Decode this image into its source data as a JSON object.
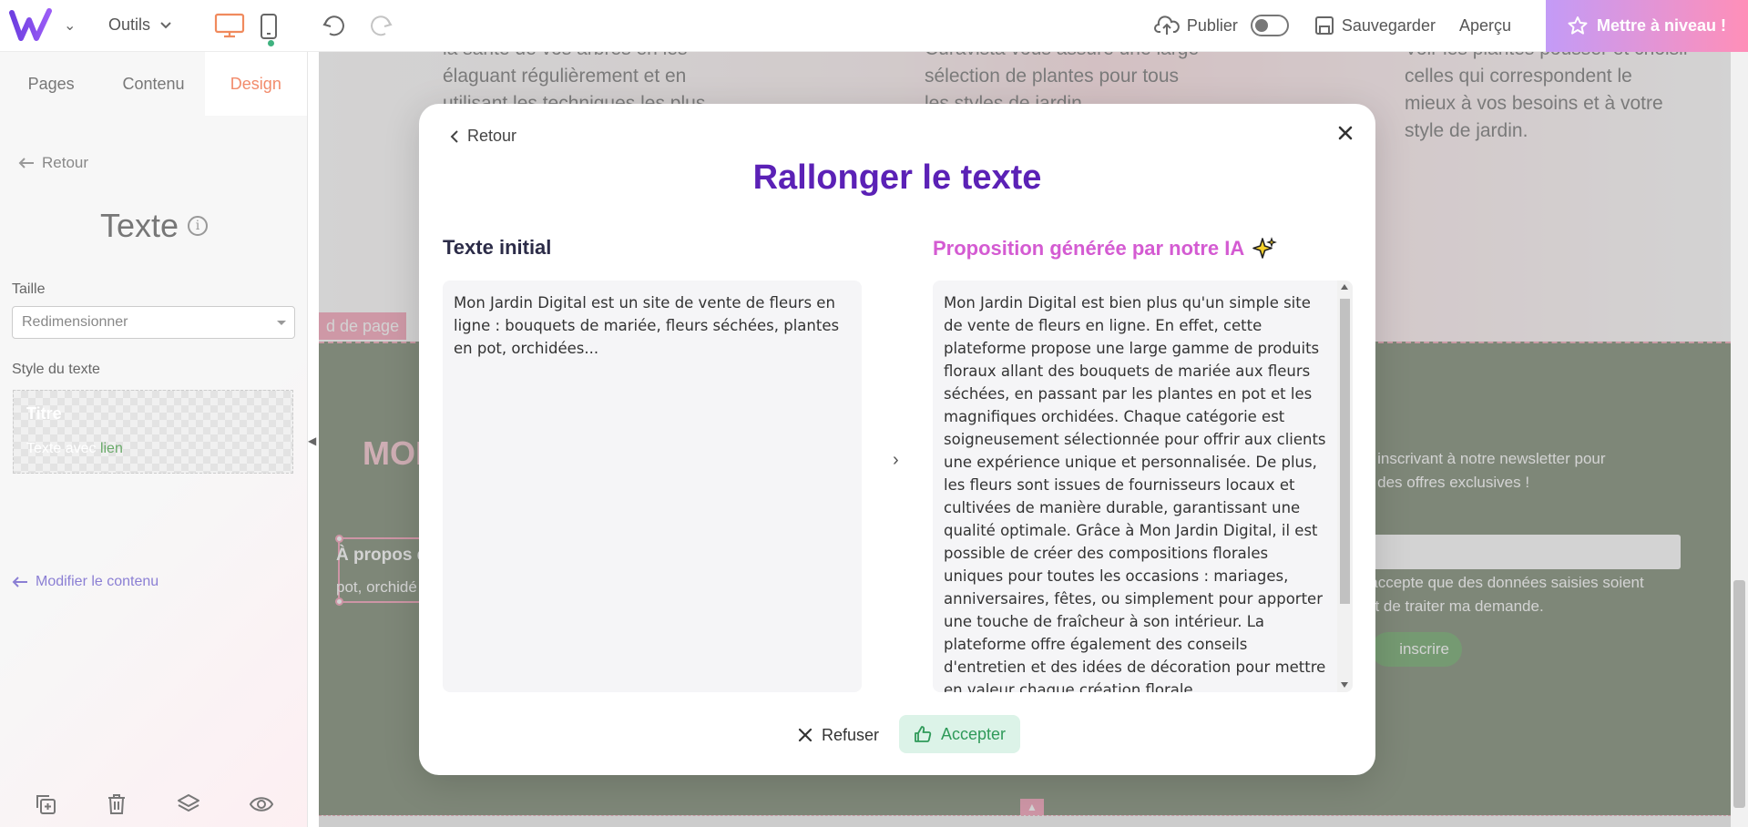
{
  "topbar": {
    "outils_label": "Outils",
    "publish_label": "Publier",
    "save_label": "Sauvegarder",
    "preview_label": "Aperçu",
    "upgrade_label": "Mettre à niveau !"
  },
  "sidebar": {
    "tabs": [
      {
        "label": "Pages"
      },
      {
        "label": "Contenu"
      },
      {
        "label": "Design"
      }
    ],
    "back_label": "Retour",
    "title": "Texte",
    "size_label": "Taille",
    "size_value": "Redimensionner",
    "style_label": "Style du texte",
    "style_preview_title": "Titre",
    "style_preview_text": "Texte avec",
    "style_preview_link": "lien",
    "modify_label": "Modifier le contenu"
  },
  "canvas": {
    "col1": [
      "la santé de vos arbres en les",
      "élaguant régulièrement et en",
      "utilisant les techniques les plus"
    ],
    "col2": [
      "Curavista vous assure une large",
      "sélection de plantes pour tous",
      "les styles de jardin."
    ],
    "col3": [
      "Voir les plantes pousser et choisir",
      "celles qui correspondent le",
      "mieux à vos besoins et à votre",
      "style de jardin."
    ],
    "page_tag": "d de page",
    "brand_partial": "MON",
    "about_title": "À propos d",
    "about_text": "pot, orchidé",
    "newsletter_text": [
      "ous inscrivant à notre newsletter pour",
      "s et des offres exclusives !"
    ],
    "consent_text": [
      "'accepte que des données saisies soient",
      "ut de traiter ma demande."
    ],
    "signup_label": "inscrire"
  },
  "modal": {
    "back_label": "Retour",
    "title": "Rallonger le texte",
    "left_title": "Texte initial",
    "right_title": "Proposition générée par notre IA",
    "initial_text": "Mon Jardin Digital est un site de vente de fleurs en ligne : bouquets de mariée, fleurs séchées, plantes en pot, orchidées...",
    "generated_text": "Mon Jardin Digital est bien plus qu'un simple site de vente de fleurs en ligne. En effet, cette plateforme propose une large gamme de produits floraux allant des bouquets de mariée aux fleurs séchées, en passant par les plantes en pot et les magnifiques orchidées. Chaque catégorie est soigneusement sélectionnée pour offrir aux clients une expérience unique et personnalisée. De plus, les fleurs sont issues de fournisseurs locaux et cultivées de manière durable, garantissant une qualité optimale. Grâce à Mon Jardin Digital, il est possible de créer des compositions florales uniques pour toutes les occasions : mariages, anniversaires, fêtes, ou simplement pour apporter une touche de fraîcheur à son intérieur. La plateforme offre également des conseils d'entretien et des idées de décoration pour mettre en valeur chaque création florale.",
    "refuse_label": "Refuser",
    "accept_label": "Accepter"
  },
  "colors": {
    "accent_purple": "#5b21b6",
    "ai_pink": "#d45bd2",
    "design_orange": "#f28b6b",
    "accept_green": "#2f9a59",
    "canvas_green": "#7d8b74"
  },
  "icons": [
    "w-logo-icon",
    "chevron-down-icon",
    "desktop-icon",
    "mobile-icon",
    "undo-icon",
    "redo-icon",
    "cloud-upload-icon",
    "save-icon",
    "star-icon",
    "arrow-left-icon",
    "info-icon",
    "duplicate-icon",
    "trash-icon",
    "layers-icon",
    "eye-icon",
    "close-icon",
    "chevron-right-icon",
    "sparkles-icon",
    "thumbs-up-icon"
  ]
}
